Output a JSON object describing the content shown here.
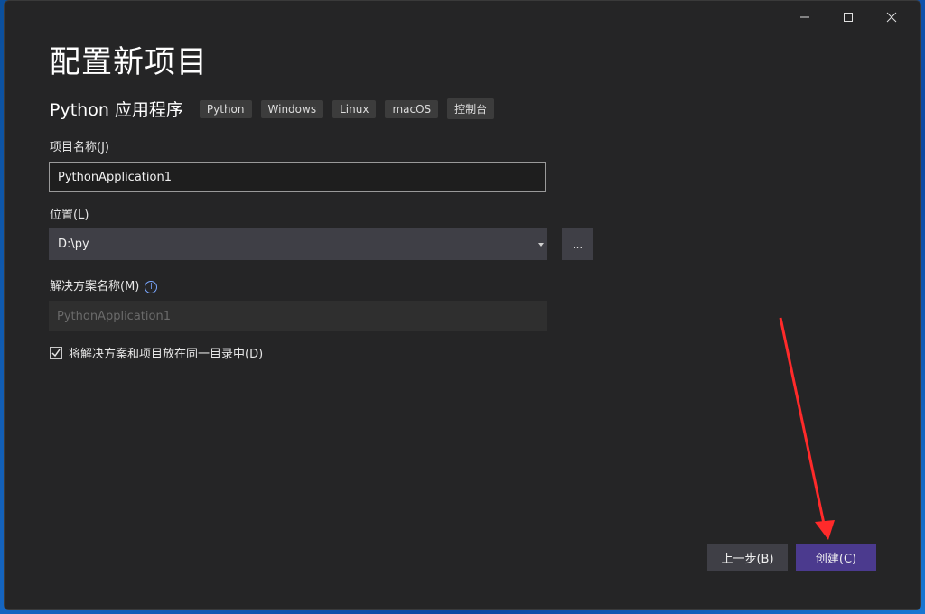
{
  "window": {
    "title": "配置新项目",
    "caption_icons": [
      "minimize-icon",
      "maximize-icon",
      "close-icon"
    ]
  },
  "template": {
    "name": "Python 应用程序",
    "tags": [
      "Python",
      "Windows",
      "Linux",
      "macOS",
      "控制台"
    ]
  },
  "project_name": {
    "label": "项目名称(J)",
    "value": "PythonApplication1"
  },
  "location": {
    "label": "位置(L)",
    "value": "D:\\py",
    "browse_label": "..."
  },
  "solution_name": {
    "label": "解决方案名称(M)",
    "placeholder": "PythonApplication1",
    "info_icon": "info-icon"
  },
  "same_dir": {
    "label": "将解决方案和项目放在同一目录中(D)",
    "checked": true
  },
  "buttons": {
    "back": "上一步(B)",
    "create": "创建(C)"
  },
  "colors": {
    "window_bg": "#252526",
    "accent": "#4b3a8e",
    "arrow": "#ff2a2a"
  }
}
